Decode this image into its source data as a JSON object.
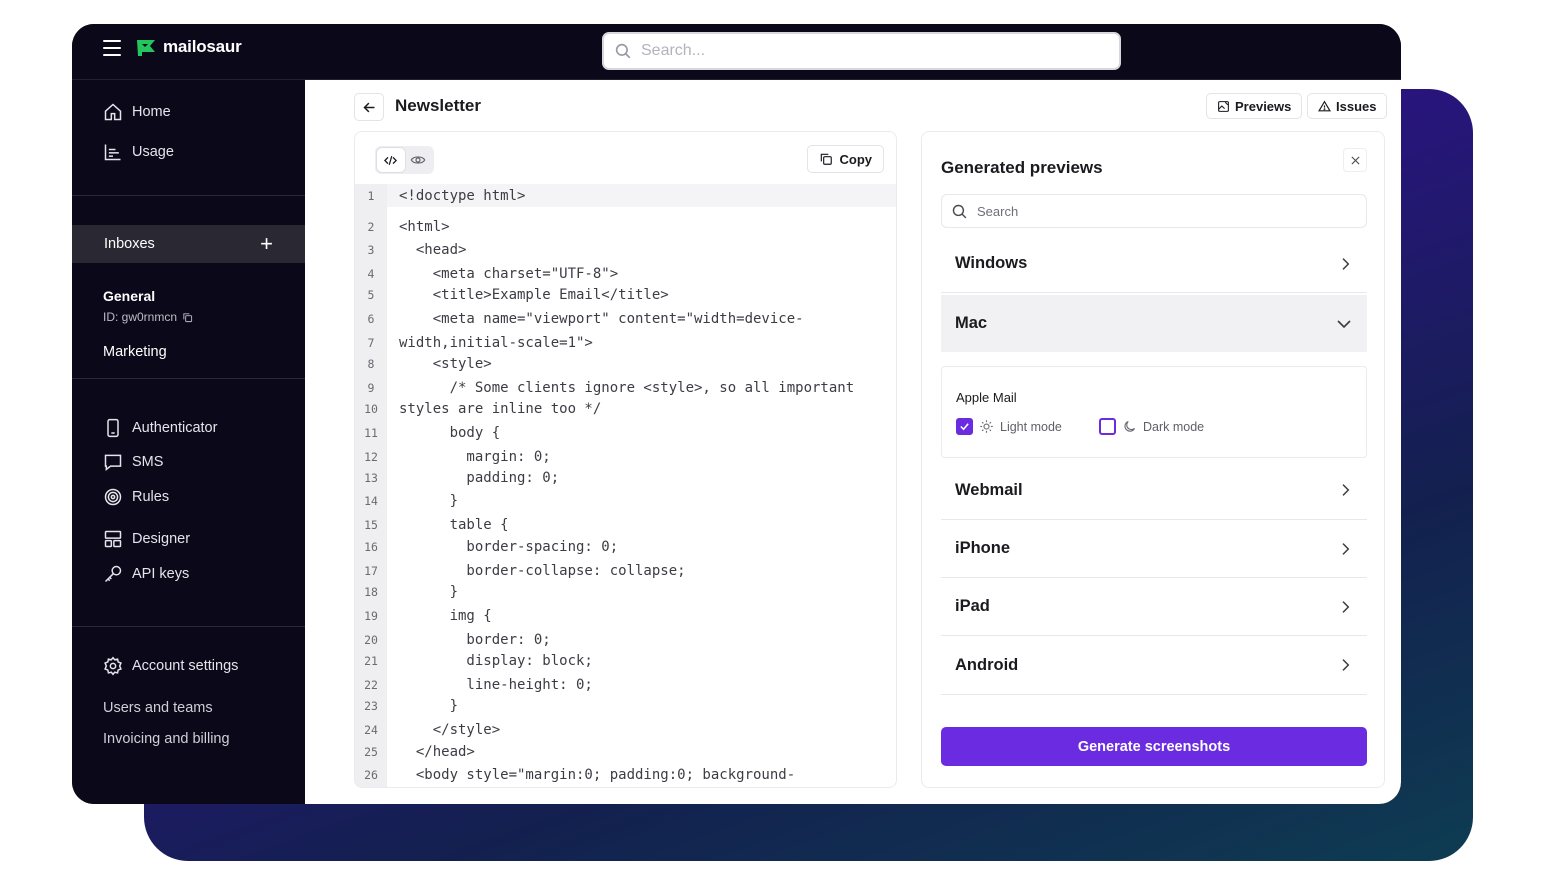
{
  "app": {
    "name": "mailosaur",
    "brand_color": "#22c55e",
    "accent_color": "#6b2be0"
  },
  "search": {
    "placeholder": "Search..."
  },
  "sidebar": {
    "home": "Home",
    "usage": "Usage",
    "inboxes_label": "Inboxes",
    "add_icon": "+",
    "inboxes": [
      {
        "name": "General",
        "id_label": "ID: gw0rnmcn"
      },
      {
        "name": "Marketing"
      }
    ],
    "tools": [
      "Authenticator",
      "SMS",
      "Rules",
      "Designer",
      "API keys"
    ],
    "account_settings": "Account settings",
    "users_teams": "Users and teams",
    "invoicing": "Invoicing and billing"
  },
  "page": {
    "title": "Newsletter",
    "previews_btn": "Previews",
    "issues_btn": "Issues"
  },
  "code": {
    "copy_label": "Copy",
    "lines": [
      {
        "n": "1",
        "t": "<!doctype html>"
      },
      {
        "n": "2",
        "t": "<html>"
      },
      {
        "n": "3",
        "t": "  <head>"
      },
      {
        "n": "4",
        "t": "    <meta charset=\"UTF-8\">"
      },
      {
        "n": "5",
        "t": "    <title>Example Email</title>"
      },
      {
        "n": "6",
        "t": "    <meta name=\"viewport\" content=\"width=device-"
      },
      {
        "n": "7",
        "t": "width,initial-scale=1\">"
      },
      {
        "n": "8",
        "t": "    <style>"
      },
      {
        "n": "9",
        "t": "      /* Some clients ignore <style>, so all important"
      },
      {
        "n": "10",
        "t": "styles are inline too */"
      },
      {
        "n": "11",
        "t": "      body {"
      },
      {
        "n": "12",
        "t": "        margin: 0;"
      },
      {
        "n": "13",
        "t": "        padding: 0;"
      },
      {
        "n": "14",
        "t": "      }"
      },
      {
        "n": "15",
        "t": "      table {"
      },
      {
        "n": "16",
        "t": "        border-spacing: 0;"
      },
      {
        "n": "17",
        "t": "        border-collapse: collapse;"
      },
      {
        "n": "18",
        "t": "      }"
      },
      {
        "n": "19",
        "t": "      img {"
      },
      {
        "n": "20",
        "t": "        border: 0;"
      },
      {
        "n": "21",
        "t": "        display: block;"
      },
      {
        "n": "22",
        "t": "        line-height: 0;"
      },
      {
        "n": "23",
        "t": "      }"
      },
      {
        "n": "24",
        "t": "    </style>"
      },
      {
        "n": "25",
        "t": "  </head>"
      },
      {
        "n": "26",
        "t": "  <body style=\"margin:0; padding:0; background-"
      }
    ]
  },
  "previews": {
    "title": "Generated previews",
    "search_placeholder": "Search",
    "groups": [
      "Windows",
      "Mac",
      "Webmail",
      "iPhone",
      "iPad",
      "Android"
    ],
    "open_group": "Mac",
    "client": {
      "name": "Apple Mail",
      "light_label": "Light mode",
      "light_checked": true,
      "dark_label": "Dark mode",
      "dark_checked": false
    },
    "generate_btn": "Generate screenshots"
  }
}
